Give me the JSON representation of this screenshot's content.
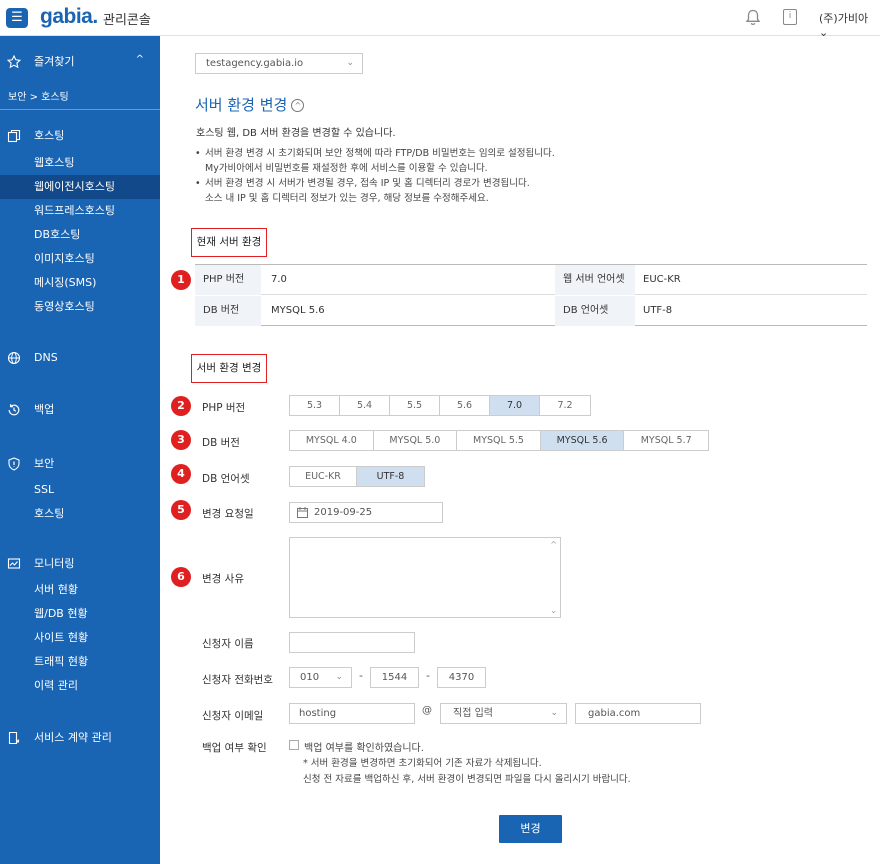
{
  "header": {
    "menu_icon": "hamburger-icon",
    "logo": "gabia.",
    "title": "관리콘솔",
    "user": "(주)가비아"
  },
  "sidebar": {
    "favorites": "즐겨찾기",
    "breadcrumb": "보안 > 호스팅",
    "hosting": {
      "label": "호스팅",
      "items": [
        "웹호스팅",
        "웹에이전시호스팅",
        "워드프레스호스팅",
        "DB호스팅",
        "이미지호스팅",
        "메시징(SMS)",
        "동영상호스팅"
      ],
      "active_index": 1
    },
    "dns": "DNS",
    "backup": "백업",
    "security": {
      "label": "보안",
      "items": [
        "SSL",
        "호스팅"
      ]
    },
    "monitoring": {
      "label": "모니터링",
      "items": [
        "서버 현황",
        "웹/DB 현황",
        "사이트 현황",
        "트래픽 현황",
        "이력 관리"
      ]
    },
    "contract": "서비스 계약 관리"
  },
  "main": {
    "domain_select": "testagency.gabia.io",
    "title": "서버 환경 변경",
    "description": "호스팅 웹, DB 서버 환경을 변경할 수 있습니다.",
    "bullets": [
      "서버 환경 변경 시 초기화되며 보안 정책에 따라 FTP/DB 비밀번호는 임의로 설정됩니다.",
      "My가비아에서 비밀번호를 재설정한 후에 서비스를 이용할 수 있습니다.",
      "서버 환경 변경 시 서버가 변경될 경우, 접속 IP 및 홈 디렉터리 경로가 변경됩니다.",
      "소스 내 IP 및 홈 디렉터리 정보가 있는 경우, 해당 정보를 수정해주세요."
    ],
    "current_heading": "현재 서버 환경",
    "current": {
      "php_label": "PHP 버전",
      "php": "7.0",
      "web_charset_label": "웹 서버 언어셋",
      "web_charset": "EUC-KR",
      "db_label": "DB 버전",
      "db": "MYSQL 5.6",
      "db_charset_label": "DB 언어셋",
      "db_charset": "UTF-8"
    },
    "change_heading": "서버 환경 변경",
    "badges": [
      "1",
      "2",
      "3",
      "4",
      "5",
      "6"
    ],
    "form": {
      "php_label": "PHP 버전",
      "php_options": [
        "5.3",
        "5.4",
        "5.5",
        "5.6",
        "7.0",
        "7.2"
      ],
      "php_selected": "7.0",
      "db_label": "DB 버전",
      "db_options": [
        "MYSQL 4.0",
        "MYSQL 5.0",
        "MYSQL 5.5",
        "MYSQL 5.6",
        "MYSQL 5.7"
      ],
      "db_selected": "MYSQL 5.6",
      "charset_label": "DB 언어셋",
      "charset_options": [
        "EUC-KR",
        "UTF-8"
      ],
      "charset_selected": "UTF-8",
      "date_label": "변경 요청일",
      "date": "2019-09-25",
      "reason_label": "변경 사유",
      "reason": "",
      "name_label": "신청자 이름",
      "name": "",
      "phone_label": "신청자 전화번호",
      "phone1": "010",
      "phone2": "1544",
      "phone3": "4370",
      "dash": "-",
      "email_label": "신청자 이메일",
      "email_id": "hosting",
      "at": "@",
      "email_select": "직접 입력",
      "email_domain": "gabia.com",
      "backup_label": "백업 여부 확인",
      "backup_checkbox": "백업 여부를 확인하였습니다.",
      "note1": "* 서버 환경을 변경하면 초기화되어 기존 자료가 삭제됩니다.",
      "note2": "신청 전 자료를 백업하신 후, 서버 환경이 변경되면 파일을 다시 올리시기 바랍니다.",
      "submit": "변경"
    }
  },
  "colors": {
    "brand": "#1a64b4",
    "active_nav": "#11498a",
    "badge": "#e02020",
    "selected_segment": "#cfdff0"
  }
}
